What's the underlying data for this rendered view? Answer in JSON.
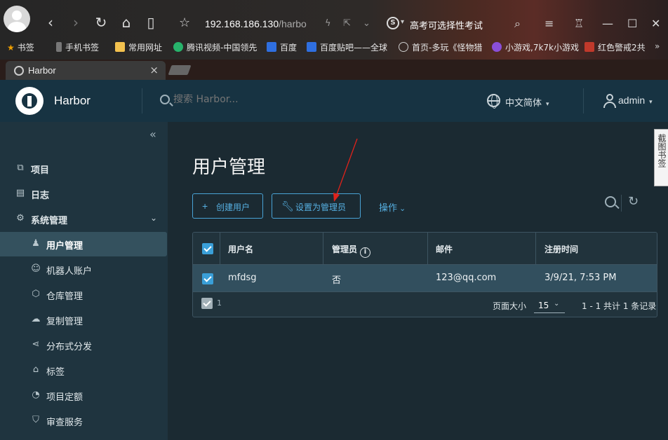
{
  "browser": {
    "url_host": "192.168.186.130",
    "url_path": "/harbo",
    "hot_search": "高考可选择性考试",
    "bookmarks": [
      {
        "label": "书签",
        "color": "#f0a000"
      },
      {
        "label": "手机书签",
        "color": "#777777"
      },
      {
        "label": "常用网址",
        "color": "#f2c14e"
      },
      {
        "label": "腾讯视频-中国领先",
        "color": "#27b36b"
      },
      {
        "label": "百度",
        "color": "#2f6fe0"
      },
      {
        "label": "百度贴吧——全球",
        "color": "#2f6fe0"
      },
      {
        "label": "首页-多玩《怪物猎",
        "color": "#cccccc"
      },
      {
        "label": "小游戏,7k7k小游戏",
        "color": "#8a4fd8"
      },
      {
        "label": "红色警戒2共",
        "color": "#c0392b"
      }
    ],
    "tab_title": "Harbor"
  },
  "header": {
    "brand": "Harbor",
    "search_placeholder": "搜索 Harbor...",
    "language": "中文简体",
    "user": "admin"
  },
  "sidebar": {
    "items": [
      {
        "label": "项目",
        "icon": "projects-icon",
        "glyph": "⧉"
      },
      {
        "label": "日志",
        "icon": "logs-icon",
        "glyph": "▤"
      },
      {
        "label": "系统管理",
        "icon": "admin-icon",
        "glyph": "⚙"
      },
      {
        "label": "用户管理",
        "icon": "users-icon",
        "glyph": "♟"
      },
      {
        "label": "机器人账户",
        "icon": "robot-icon",
        "glyph": "☺"
      },
      {
        "label": "仓库管理",
        "icon": "registry-icon",
        "glyph": "⬡"
      },
      {
        "label": "复制管理",
        "icon": "replication-icon",
        "glyph": "☁"
      },
      {
        "label": "分布式分发",
        "icon": "distribution-icon",
        "glyph": "⋖"
      },
      {
        "label": "标签",
        "icon": "tag-icon",
        "glyph": "⌂"
      },
      {
        "label": "项目定额",
        "icon": "quota-icon",
        "glyph": "◔"
      },
      {
        "label": "审查服务",
        "icon": "shield-icon",
        "glyph": "⛉"
      }
    ]
  },
  "main": {
    "title": "用户管理",
    "create_user": "创建用户",
    "set_admin": "设置为管理员",
    "actions": "操作",
    "columns": [
      "用户名",
      "管理员",
      "邮件",
      "注册时间"
    ],
    "rows": [
      {
        "username": "mfdsg",
        "admin": "否",
        "email": "123@qq.com",
        "registered": "3/9/21, 7:53 PM"
      }
    ],
    "selected_count": "1",
    "page_size_label": "页面大小",
    "page_size": "15",
    "summary": "1 - 1 共计 1 条记录"
  },
  "side_widget": "截图书签",
  "colors": {
    "accent": "#56b0e2",
    "header_bg": "#173342",
    "sidebar_bg": "#1f343f",
    "arrow": "#e0221b"
  }
}
